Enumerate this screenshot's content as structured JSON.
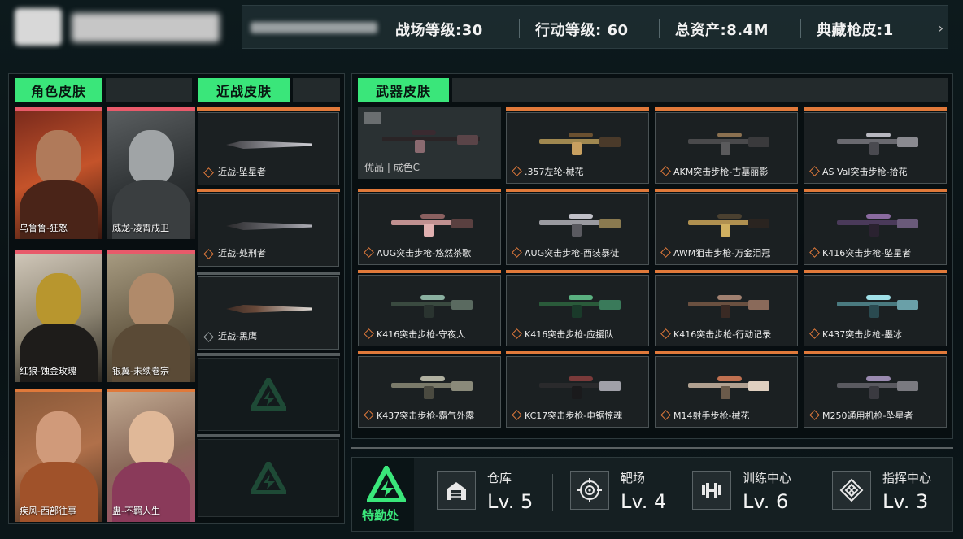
{
  "header": {
    "stats": [
      {
        "label": "战场等级:30"
      },
      {
        "label": "行动等级: 60"
      },
      {
        "label": "总资产:8.4M"
      },
      {
        "label": "典藏枪皮:1"
      }
    ],
    "more_icon": "chevron-right-icon"
  },
  "sections": {
    "character": "角色皮肤",
    "melee": "近战皮肤",
    "weapon": "武器皮肤"
  },
  "characters": [
    {
      "label": "乌鲁鲁-狂怒"
    },
    {
      "label": "威龙-凌霄戍卫"
    },
    {
      "label": "红狼-蚀金玫瑰"
    },
    {
      "label": "银翼-未续卷宗"
    },
    {
      "label": "疾风-西部往事"
    },
    {
      "label": "蛊-不羁人生"
    }
  ],
  "melee": [
    {
      "label": "近战-坠星者"
    },
    {
      "label": "近战-处刑者"
    },
    {
      "label": "近战-黑鹰"
    }
  ],
  "weapons": {
    "first_tag": "优品 | 成色C",
    "items": [
      {
        "label": ".357左轮-械花"
      },
      {
        "label": "AKM突击步枪-古墓丽影"
      },
      {
        "label": "AS Val突击步枪-拾花"
      },
      {
        "label": "AUG突击步枪-悠然茶歌"
      },
      {
        "label": "AUG突击步枪-西装暴徒"
      },
      {
        "label": "AWM狙击步枪-万金泪冠"
      },
      {
        "label": "K416突击步枪-坠星者"
      },
      {
        "label": "K416突击步枪-守夜人"
      },
      {
        "label": "K416突击步枪-应援队"
      },
      {
        "label": "K416突击步枪-行动记录"
      },
      {
        "label": "K437突击步枪-墨冰"
      },
      {
        "label": "K437突击步枪-霸气外露"
      },
      {
        "label": "KC17突击步枪-电锯惊魂"
      },
      {
        "label": "M14射手步枪-械花"
      },
      {
        "label": "M250通用机枪-坠星者"
      }
    ]
  },
  "special_ops": {
    "label": "特勤处",
    "facilities": [
      {
        "name": "仓库",
        "level": "Lv. 5",
        "icon": "warehouse-icon"
      },
      {
        "name": "靶场",
        "level": "Lv. 4",
        "icon": "target-icon"
      },
      {
        "name": "训练中心",
        "level": "Lv. 6",
        "icon": "dumbbell-icon"
      },
      {
        "name": "指挥中心",
        "level": "Lv. 3",
        "icon": "command-icon"
      }
    ]
  },
  "colors": {
    "accent_green": "#3ae67a",
    "accent_orange": "#e0793a",
    "character_red": "#e85a6a"
  }
}
